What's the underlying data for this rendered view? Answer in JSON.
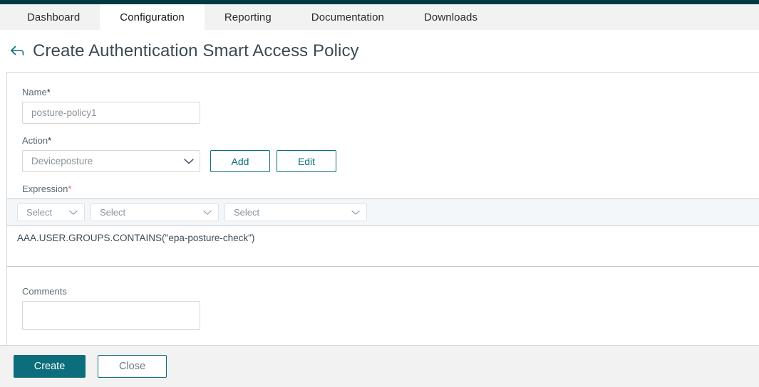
{
  "nav": {
    "tabs": [
      {
        "label": "Dashboard",
        "active": false
      },
      {
        "label": "Configuration",
        "active": true
      },
      {
        "label": "Reporting",
        "active": false
      },
      {
        "label": "Documentation",
        "active": false
      },
      {
        "label": "Downloads",
        "active": false
      }
    ]
  },
  "header": {
    "back_icon": "back-arrow-icon",
    "title": "Create Authentication Smart Access Policy"
  },
  "form": {
    "name": {
      "label": "Name",
      "required_mark": "*",
      "value": "posture-policy1",
      "placeholder": "posture-policy1"
    },
    "action": {
      "label": "Action",
      "required_mark": "*",
      "selected": "Deviceposture",
      "add_label": "Add",
      "edit_label": "Edit"
    },
    "expression": {
      "label": "Expression",
      "required_mark": "*",
      "selects": [
        {
          "value": "Select"
        },
        {
          "value": "Select"
        },
        {
          "value": "Select"
        }
      ],
      "text": "AAA.USER.GROUPS.CONTAINS(\"epa-posture-check\")"
    },
    "comments": {
      "label": "Comments",
      "value": "",
      "placeholder": ""
    }
  },
  "footer": {
    "create_label": "Create",
    "close_label": "Close"
  },
  "colors": {
    "top_strip": "#003b44",
    "accent_teal": "#0c6e7d",
    "tabbar_bg": "#f2f2f2",
    "expr_toolbar_bg": "#f4f7fa",
    "required_orange": "#e8643c",
    "label_gray": "#5a6872"
  }
}
